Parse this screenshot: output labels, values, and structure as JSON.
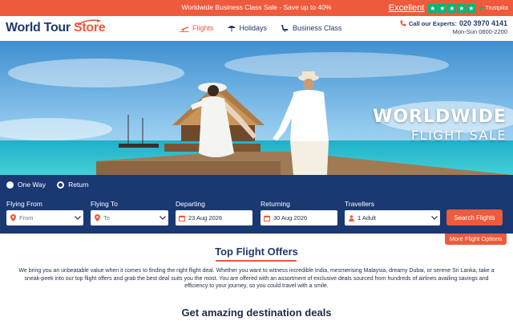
{
  "promo": {
    "text": "Worldwide Business Class Sale - Save up to 40%",
    "rating_label": "Excellent",
    "brand": "Trustpilot",
    "star_icons": [
      "star-icon",
      "star-icon",
      "star-icon",
      "star-icon",
      "star-icon"
    ]
  },
  "header": {
    "logo_main": "World Tour ",
    "logo_accent": "Store",
    "nav": [
      {
        "label": "Flights",
        "icon": "plane-icon",
        "active": true
      },
      {
        "label": "Holidays",
        "icon": "umbrella-icon",
        "active": false
      },
      {
        "label": "Business Class",
        "icon": "seat-icon",
        "active": false
      }
    ],
    "contact_label": "Call our Experts:",
    "phone": "020 3970 4141",
    "hours": "Mon-Sun 0800-2200"
  },
  "hero": {
    "title_line1": "WORLDWIDE",
    "title_line2": "FLIGHT SALE"
  },
  "search": {
    "trip_options": [
      {
        "label": "One Way",
        "checked": false
      },
      {
        "label": "Return",
        "checked": true
      }
    ],
    "flying_from": {
      "label": "Flying From",
      "placeholder": "From"
    },
    "flying_to": {
      "label": "Flying To",
      "placeholder": "To"
    },
    "departing": {
      "label": "Departing",
      "value": "23 Aug 2026"
    },
    "returning": {
      "label": "Returning",
      "value": "30 Aug 2026"
    },
    "travellers": {
      "label": "Travellers",
      "value": "1 Adult"
    },
    "search_button": "Search Flights",
    "more_options": "More Flight Options"
  },
  "offers": {
    "title": "Top Flight Offers",
    "description": "We bring you an unbeatable value when it comes to finding the right flight deal. Whether you want to witness incredible India, mesmerising Malaysia, dreamy Dubai, or serene Sri Lanka, take a sneak-peek into our top flight offers and grab the best deal suits you the most. You are offered with an assortment of exclusive deals sourced from hundreds of airlines availing savings and efficiency to your journey, so you could travel with a smile.",
    "deals_title": "Get amazing destination deals"
  },
  "colors": {
    "accent": "#ee5a3c",
    "navy": "#1a3872",
    "trustpilot_green": "#00b67a"
  }
}
